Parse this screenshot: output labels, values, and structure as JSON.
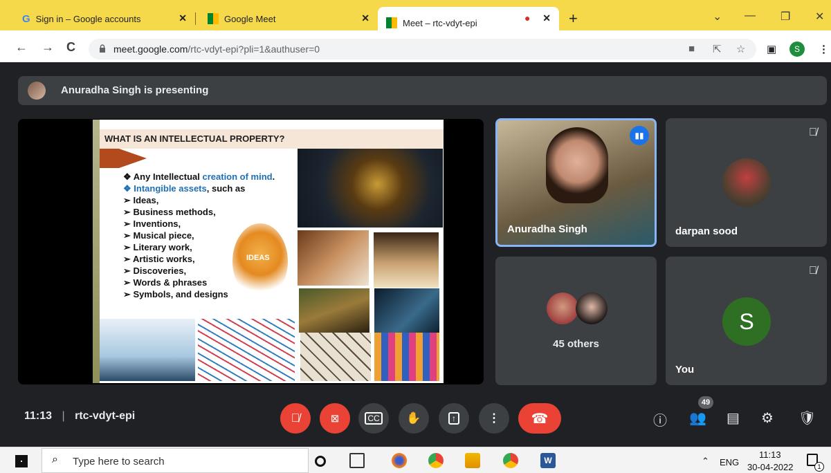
{
  "browser": {
    "tabs": [
      {
        "title": "Sign in – Google accounts",
        "close": "✕"
      },
      {
        "title": "Google Meet",
        "close": "✕"
      },
      {
        "title": "Meet – rtc-vdyt-epi",
        "close": "✕",
        "recording": "●"
      }
    ],
    "new_tab": "+",
    "window": {
      "minimize": "—",
      "restore": "❐",
      "close": "✕",
      "dropdown": "⌄"
    },
    "nav": {
      "back": "←",
      "forward": "→",
      "reload": "C"
    },
    "url_host": "meet.google.com",
    "url_path": "/rtc-vdyt-epi?pli=1&authuser=0",
    "profile_initial": "S",
    "menu": "⋮"
  },
  "meet": {
    "presenting_text": "Anuradha Singh is presenting",
    "slide": {
      "title": "WHAT IS AN INTELLECTUAL PROPERTY?",
      "bullets": [
        {
          "prefix": "❖ Any Intellectual ",
          "highlight": "creation of mind",
          "suffix": "."
        },
        {
          "prefix": "",
          "highlight": "❖ Intangible assets",
          "suffix": ", such as"
        },
        {
          "prefix": "➢ Ideas,",
          "highlight": "",
          "suffix": ""
        },
        {
          "prefix": "➢  Business methods,",
          "highlight": "",
          "suffix": ""
        },
        {
          "prefix": "➢ Inventions,",
          "highlight": "",
          "suffix": ""
        },
        {
          "prefix": "➢ Musical piece,",
          "highlight": "",
          "suffix": ""
        },
        {
          "prefix": "➢ Literary work,",
          "highlight": "",
          "suffix": ""
        },
        {
          "prefix": "➢ Artistic works,",
          "highlight": "",
          "suffix": ""
        },
        {
          "prefix": "➢ Discoveries,",
          "highlight": "",
          "suffix": ""
        },
        {
          "prefix": "➢ Words & phrases",
          "highlight": "",
          "suffix": ""
        },
        {
          "prefix": "➢ Symbols, and designs",
          "highlight": "",
          "suffix": ""
        }
      ],
      "ideas_label": "IDEAS"
    },
    "participants": [
      {
        "name": "Anuradha Singh"
      },
      {
        "name": "darpan sood"
      },
      {
        "name": "45 others"
      },
      {
        "name": "You",
        "initial": "S"
      }
    ],
    "time": "11:13",
    "meeting_code": "rtc-vdyt-epi",
    "separator": "|",
    "people_count": "49"
  },
  "taskbar": {
    "search_placeholder": "Type here to search",
    "tray_lang": "ENG",
    "tray_time": "11:13",
    "tray_date": "30-04-2022",
    "notification_count": "1"
  }
}
